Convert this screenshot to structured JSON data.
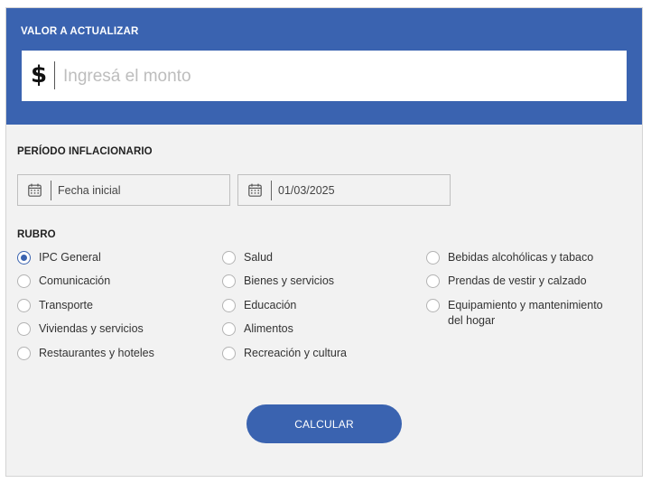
{
  "header": {
    "label": "VALOR A ACTUALIZAR",
    "currency_symbol": "$",
    "amount_placeholder": "Ingresá el monto",
    "amount_value": "",
    "background_color": "#3a63b0"
  },
  "period": {
    "label": "PERÍODO INFLACIONARIO",
    "start": {
      "icon": "calendar-icon",
      "placeholder": "Fecha inicial",
      "value": ""
    },
    "end": {
      "icon": "calendar-icon",
      "value": "01/03/2025"
    }
  },
  "rubro": {
    "label": "RUBRO",
    "selected": "IPC General",
    "options": [
      "IPC General",
      "Comunicación",
      "Transporte",
      "Viviendas y servicios",
      "Restaurantes y hoteles",
      "Salud",
      "Bienes y servicios",
      "Educación",
      "Alimentos",
      "Recreación y cultura",
      "Bebidas alcohólicas y tabaco",
      "Prendas de vestir y calzado",
      "Equipamiento y mantenimiento del hogar"
    ]
  },
  "actions": {
    "calculate_label": "CALCULAR",
    "accent_color": "#3a63b0"
  }
}
